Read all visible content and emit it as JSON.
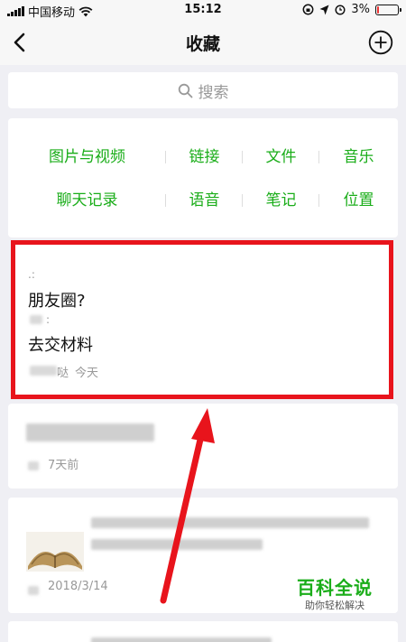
{
  "status_bar": {
    "carrier": "中国移动",
    "time": "15:12",
    "battery": "3%",
    "battery_level": 0.03
  },
  "nav": {
    "title": "收藏"
  },
  "search": {
    "placeholder": "搜索"
  },
  "categories": [
    [
      "图片与视频",
      "链接",
      "文件",
      "音乐"
    ],
    [
      "聊天记录",
      "语音",
      "笔记",
      "位置"
    ]
  ],
  "items": [
    {
      "line1": "朋友圈?",
      "line2": "去交材料",
      "source_suffix": "哒",
      "time": "今天"
    },
    {
      "time": "7天前"
    },
    {
      "time": "2018/3/14"
    }
  ],
  "watermark": {
    "title": "百科全说",
    "subtitle": "助你轻松解决"
  },
  "colors": {
    "accent": "#1aad19",
    "highlight": "#e8141c"
  }
}
